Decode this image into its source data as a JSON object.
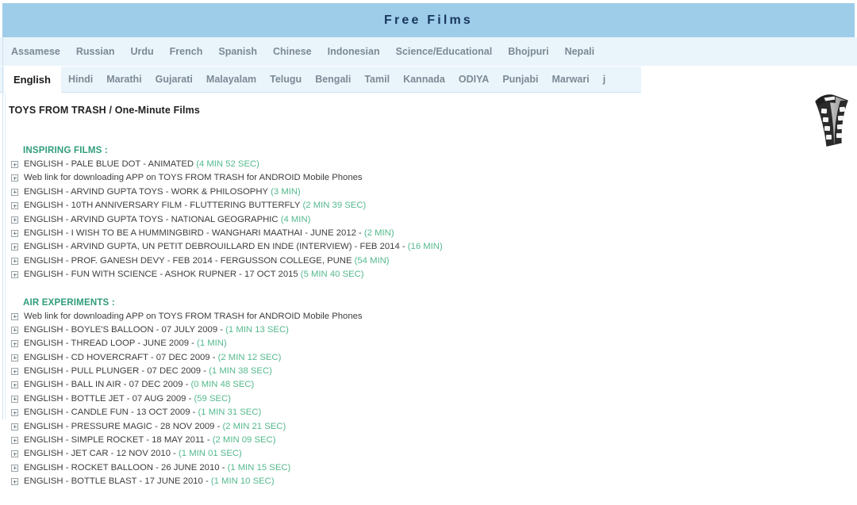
{
  "header": {
    "title": "Free Films"
  },
  "nav": {
    "row1": [
      {
        "label": "Assamese",
        "active": false
      },
      {
        "label": "Russian",
        "active": false
      },
      {
        "label": "Urdu",
        "active": false
      },
      {
        "label": "French",
        "active": false
      },
      {
        "label": "Spanish",
        "active": false
      },
      {
        "label": "Chinese",
        "active": false
      },
      {
        "label": "Indonesian",
        "active": false
      },
      {
        "label": "Science/Educational",
        "active": false
      },
      {
        "label": "Bhojpuri",
        "active": false
      },
      {
        "label": "Nepali",
        "active": false
      }
    ],
    "row2": [
      {
        "label": "English",
        "active": true
      },
      {
        "label": "Hindi",
        "active": false
      },
      {
        "label": "Marathi",
        "active": false
      },
      {
        "label": "Gujarati",
        "active": false
      },
      {
        "label": "Malayalam",
        "active": false
      },
      {
        "label": "Telugu",
        "active": false
      },
      {
        "label": "Bengali",
        "active": false
      },
      {
        "label": "Tamil",
        "active": false
      },
      {
        "label": "Kannada",
        "active": false
      },
      {
        "label": "ODIYA",
        "active": false
      },
      {
        "label": "Punjabi",
        "active": false
      },
      {
        "label": "Marwari",
        "active": false
      },
      {
        "label": "j",
        "active": false
      }
    ]
  },
  "main": {
    "page_title": "TOYS FROM TRASH / One-Minute Films",
    "icon": "filmstrip-icon",
    "sections": [
      {
        "heading": "INSPIRING FILMS :",
        "items": [
          {
            "label": "ENGLISH - PALE BLUE DOT - ANIMATED",
            "duration": "(4 MIN 52 SEC)"
          },
          {
            "label": "Web link for downloading APP on TOYS FROM TRASH for ANDROID Mobile Phones",
            "duration": ""
          },
          {
            "label": "ENGLISH - ARVIND GUPTA TOYS - WORK & PHILOSOPHY",
            "duration": "(3 MIN)"
          },
          {
            "label": "ENGLISH - 10TH ANNIVERSARY FILM - FLUTTERING BUTTERFLY",
            "duration": "(2 MIN 39 SEC)"
          },
          {
            "label": "ENGLISH - ARVIND GUPTA TOYS - NATIONAL GEOGRAPHIC",
            "duration": "(4 MIN)"
          },
          {
            "label": "ENGLISH - I WISH TO BE A HUMMINGBIRD - WANGHARI MAATHAI - JUNE 2012 -",
            "duration": "(2 MIN)"
          },
          {
            "label": "ENGLISH - ARVIND GUPTA, UN PETIT DEBROUILLARD EN INDE (INTERVIEW) - FEB 2014 -",
            "duration": "(16 MIN)"
          },
          {
            "label": "ENGLISH - PROF. GANESH DEVY - FEB 2014 - FERGUSSON COLLEGE, PUNE",
            "duration": "(54 MIN)"
          },
          {
            "label": "ENGLISH - FUN WITH SCIENCE - ASHOK RUPNER - 17 OCT 2015",
            "duration": "(5 MIN 40 SEC)"
          }
        ]
      },
      {
        "heading": "AIR EXPERIMENTS :",
        "items": [
          {
            "label": "Web link for downloading APP on TOYS FROM TRASH for ANDROID Mobile Phones",
            "duration": ""
          },
          {
            "label": "ENGLISH - BOYLE'S BALLOON - 07 JULY 2009 -",
            "duration": "(1 MIN 13 SEC)"
          },
          {
            "label": "ENGLISH - THREAD LOOP - JUNE 2009 -",
            "duration": "(1 MIN)"
          },
          {
            "label": "ENGLISH - CD HOVERCRAFT - 07 DEC 2009 -",
            "duration": "(2 MIN 12 SEC)"
          },
          {
            "label": "ENGLISH - PULL PLUNGER - 07 DEC 2009 -",
            "duration": "(1 MIN 38 SEC)"
          },
          {
            "label": "ENGLISH - BALL IN AIR - 07 DEC 2009 -",
            "duration": "(0 MIN 48 SEC)"
          },
          {
            "label": "ENGLISH - BOTTLE JET - 07 AUG 2009 -",
            "duration": "(59 SEC)"
          },
          {
            "label": "ENGLISH - CANDLE FUN - 13 OCT 2009 -",
            "duration": "(1 MIN 31 SEC)"
          },
          {
            "label": "ENGLISH - PRESSURE MAGIC - 28 NOV 2009 -",
            "duration": "(2 MIN 21 SEC)"
          },
          {
            "label": "ENGLISH - SIMPLE ROCKET - 18 MAY 2011 -",
            "duration": "(2 MIN 09 SEC)"
          },
          {
            "label": "ENGLISH - JET CAR - 12 NOV 2010 -",
            "duration": "(1 MIN 01 SEC)"
          },
          {
            "label": "ENGLISH - ROCKET BALLOON - 26 JUNE 2010 -",
            "duration": "(1 MIN 15 SEC)"
          },
          {
            "label": "ENGLISH - BOTTLE BLAST - 17 JUNE 2010 -",
            "duration": "(1 MIN 10 SEC)"
          }
        ]
      }
    ]
  },
  "colors": {
    "header_bg": "#9ecde9",
    "header_text": "#17365d",
    "nav_bg": "#eaf4fb",
    "section_heading": "#2f9d7b",
    "duration": "#53b98c"
  }
}
